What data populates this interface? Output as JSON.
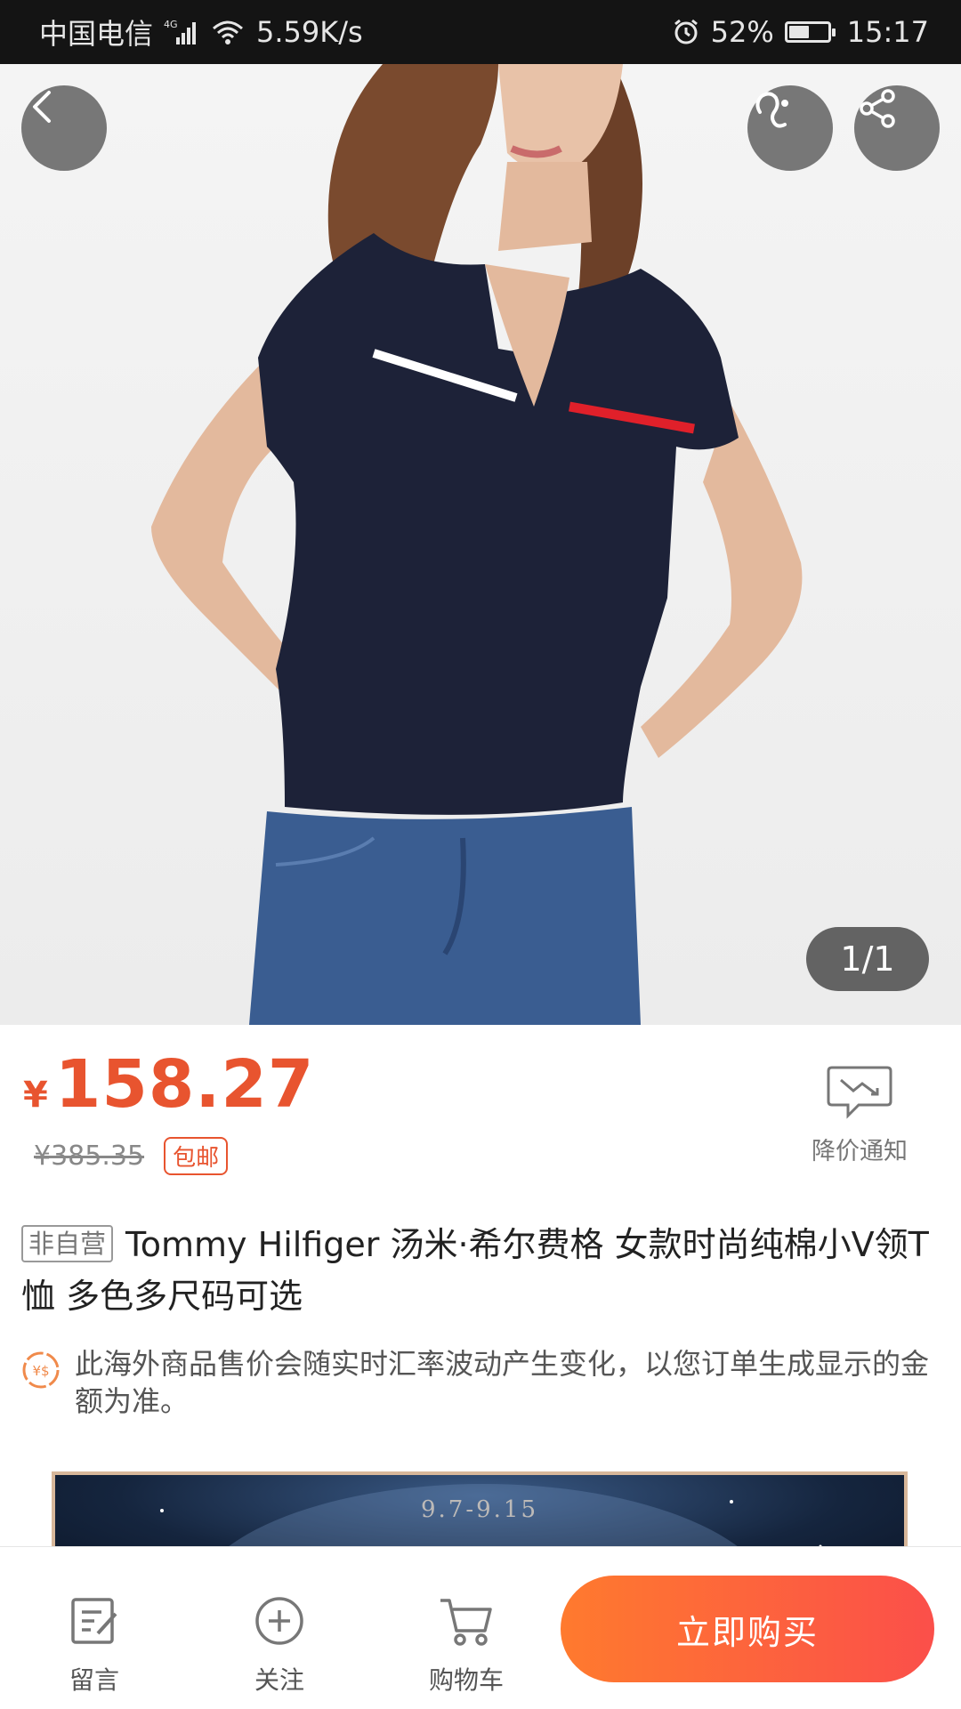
{
  "status_bar": {
    "carrier": "中国电信",
    "network": "4G",
    "speed": "5.59K/s",
    "battery": "52%",
    "battery_level": 0.52,
    "time": "15:17"
  },
  "gallery": {
    "page_indicator": "1/1",
    "icons": [
      "back-icon",
      "footprint-icon",
      "share-icon"
    ]
  },
  "price": {
    "currency": "¥",
    "current": "158.27",
    "original": "¥385.35",
    "shipping_tag": "包邮",
    "drop_notice": "降价通知"
  },
  "product": {
    "tag": "非自营",
    "title": "Tommy Hilfiger 汤米·希尔费格 女款时尚纯棉小V领T恤 多色多尺码可选",
    "notice": "此海外商品售价会随实时汇率波动产生变化，以您订单生成显示的金额为准。"
  },
  "banner": {
    "date": "9.7-9.15"
  },
  "bottom_bar": {
    "message": "留言",
    "follow": "关注",
    "cart": "购物车",
    "buy_now": "立即购买"
  },
  "colors": {
    "accent": "#e8542f",
    "buy_gradient_start": "#ff7a2e",
    "buy_gradient_end": "#fb4f4a"
  }
}
